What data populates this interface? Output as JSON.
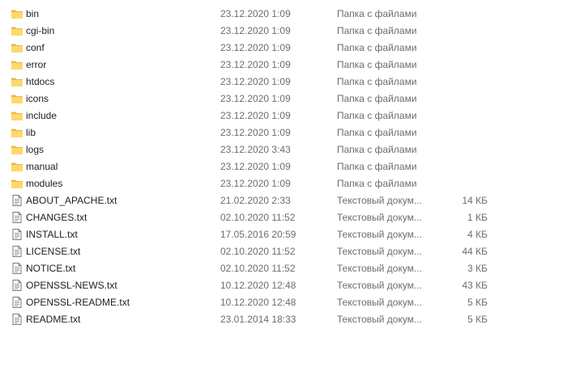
{
  "colors": {
    "folder_fill": "#ffd86b",
    "folder_back": "#e9b949",
    "text": "#1e1e1e",
    "meta_text": "#6d6d6d",
    "hover": "#e5f3ff"
  },
  "files": [
    {
      "name": "bin",
      "date": "23.12.2020 1:09",
      "type": "Папка с файлами",
      "size": "",
      "icon": "folder-icon"
    },
    {
      "name": "cgi-bin",
      "date": "23.12.2020 1:09",
      "type": "Папка с файлами",
      "size": "",
      "icon": "folder-icon"
    },
    {
      "name": "conf",
      "date": "23.12.2020 1:09",
      "type": "Папка с файлами",
      "size": "",
      "icon": "folder-icon"
    },
    {
      "name": "error",
      "date": "23.12.2020 1:09",
      "type": "Папка с файлами",
      "size": "",
      "icon": "folder-icon"
    },
    {
      "name": "htdocs",
      "date": "23.12.2020 1:09",
      "type": "Папка с файлами",
      "size": "",
      "icon": "folder-icon"
    },
    {
      "name": "icons",
      "date": "23.12.2020 1:09",
      "type": "Папка с файлами",
      "size": "",
      "icon": "folder-icon"
    },
    {
      "name": "include",
      "date": "23.12.2020 1:09",
      "type": "Папка с файлами",
      "size": "",
      "icon": "folder-icon"
    },
    {
      "name": "lib",
      "date": "23.12.2020 1:09",
      "type": "Папка с файлами",
      "size": "",
      "icon": "folder-icon"
    },
    {
      "name": "logs",
      "date": "23.12.2020 3:43",
      "type": "Папка с файлами",
      "size": "",
      "icon": "folder-icon"
    },
    {
      "name": "manual",
      "date": "23.12.2020 1:09",
      "type": "Папка с файлами",
      "size": "",
      "icon": "folder-icon"
    },
    {
      "name": "modules",
      "date": "23.12.2020 1:09",
      "type": "Папка с файлами",
      "size": "",
      "icon": "folder-icon"
    },
    {
      "name": "ABOUT_APACHE.txt",
      "date": "21.02.2020 2:33",
      "type": "Текстовый докум...",
      "size": "14 КБ",
      "icon": "text-file-icon"
    },
    {
      "name": "CHANGES.txt",
      "date": "02.10.2020 11:52",
      "type": "Текстовый докум...",
      "size": "1 КБ",
      "icon": "text-file-icon"
    },
    {
      "name": "INSTALL.txt",
      "date": "17.05.2016 20:59",
      "type": "Текстовый докум...",
      "size": "4 КБ",
      "icon": "text-file-icon"
    },
    {
      "name": "LICENSE.txt",
      "date": "02.10.2020 11:52",
      "type": "Текстовый докум...",
      "size": "44 КБ",
      "icon": "text-file-icon"
    },
    {
      "name": "NOTICE.txt",
      "date": "02.10.2020 11:52",
      "type": "Текстовый докум...",
      "size": "3 КБ",
      "icon": "text-file-icon"
    },
    {
      "name": "OPENSSL-NEWS.txt",
      "date": "10.12.2020 12:48",
      "type": "Текстовый докум...",
      "size": "43 КБ",
      "icon": "text-file-icon"
    },
    {
      "name": "OPENSSL-README.txt",
      "date": "10.12.2020 12:48",
      "type": "Текстовый докум...",
      "size": "5 КБ",
      "icon": "text-file-icon"
    },
    {
      "name": "README.txt",
      "date": "23.01.2014 18:33",
      "type": "Текстовый докум...",
      "size": "5 КБ",
      "icon": "text-file-icon"
    }
  ]
}
